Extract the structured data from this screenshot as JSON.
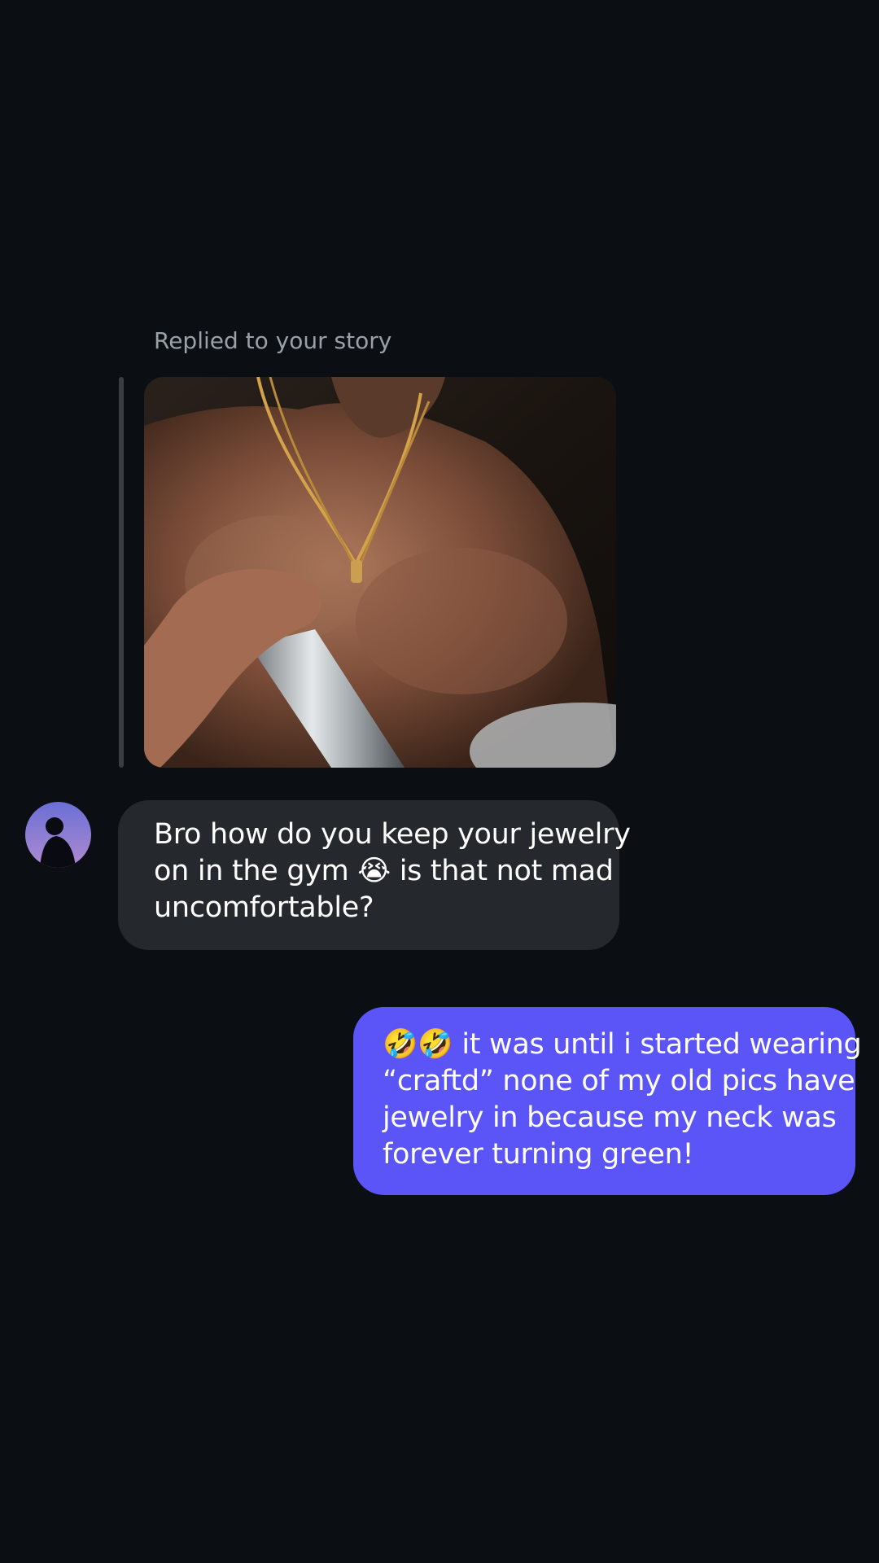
{
  "story_reply": {
    "label": "Replied to your story"
  },
  "messages": [
    {
      "direction": "incoming",
      "lines": [
        "Bro how do you keep your jewelry",
        "on in the gym 😭 is that not mad",
        "uncomfortable?"
      ]
    },
    {
      "direction": "outgoing",
      "lines": [
        "🤣🤣 it was until i started wearing",
        "“craftd” none of my old pics have",
        "jewelry in because my neck was",
        "forever turning green!"
      ]
    }
  ],
  "colors": {
    "background": "#0b0f13",
    "incoming_bubble": "#25282d",
    "outgoing_bubble": "#5b54f6",
    "secondary_text": "#9aa0a8"
  },
  "icons": {
    "avatar": "person-silhouette-avatar"
  }
}
